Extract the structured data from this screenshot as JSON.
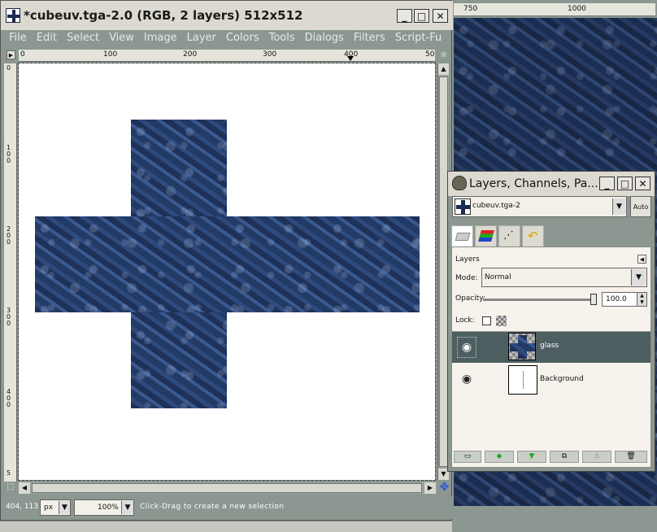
{
  "main_window": {
    "title": "*cubeuv.tga-2.0 (RGB, 2 layers) 512x512",
    "menu": [
      "File",
      "Edit",
      "Select",
      "View",
      "Image",
      "Layer",
      "Colors",
      "Tools",
      "Dialogs",
      "Filters",
      "Script-Fu"
    ],
    "hruler": [
      "0",
      "100",
      "200",
      "300",
      "400",
      "50"
    ],
    "vruler": [
      "0",
      "1\n0\n0",
      "2\n0\n0",
      "3\n0\n0",
      "4\n0\n0",
      "5"
    ],
    "status": {
      "coords": "404, 113",
      "unit": "px",
      "zoom": "100%",
      "message": "Click-Drag to create a new selection"
    }
  },
  "bg_window": {
    "ruler": [
      "750",
      "1000"
    ]
  },
  "layers_dialog": {
    "title": "Layers, Channels, Pa...",
    "image_select": "cubeuv.tga-2",
    "auto_label": "Auto",
    "section_label": "Layers",
    "mode_label": "Mode:",
    "mode_value": "Normal",
    "opacity_label": "Opacity:",
    "opacity_value": "100.0",
    "lock_label": "Lock:",
    "layers": [
      {
        "name": "glass",
        "selected": true
      },
      {
        "name": "Background",
        "selected": false
      }
    ]
  },
  "colors": {
    "titlebar": "#dcdad0",
    "window_bg": "#8b9790",
    "selection": "#4d5e60"
  }
}
